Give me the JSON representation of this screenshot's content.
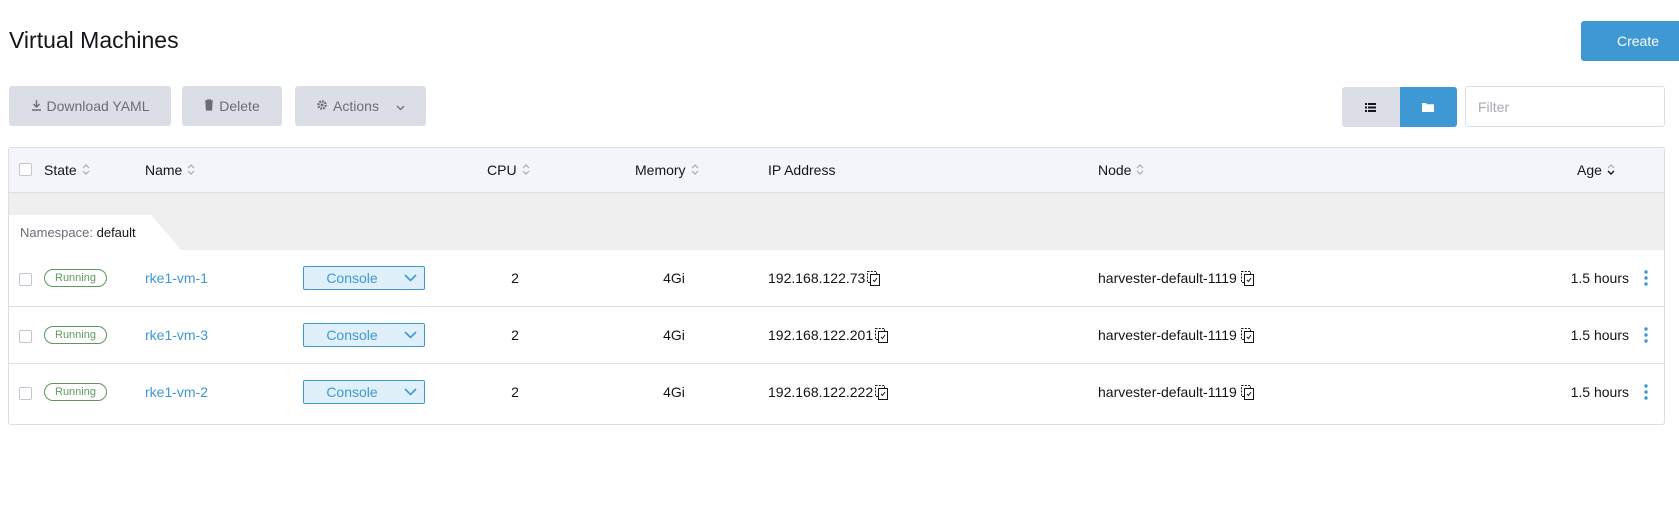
{
  "page": {
    "title": "Virtual Machines",
    "create_label": "Create"
  },
  "toolbar": {
    "download_label": "Download YAML",
    "delete_label": "Delete",
    "actions_label": "Actions",
    "filter_placeholder": "Filter"
  },
  "table": {
    "columns": {
      "state": "State",
      "name": "Name",
      "cpu": "CPU",
      "memory": "Memory",
      "ip": "IP Address",
      "node": "Node",
      "age": "Age"
    },
    "group": {
      "prefix": "Namespace:",
      "value": "default"
    },
    "rows": [
      {
        "state": "Running",
        "name": "rke1-vm-1",
        "console": "Console",
        "cpu": "2",
        "memory": "4Gi",
        "ip": "192.168.122.73",
        "node": "harvester-default-1119",
        "age": "1.5 hours"
      },
      {
        "state": "Running",
        "name": "rke1-vm-3",
        "console": "Console",
        "cpu": "2",
        "memory": "4Gi",
        "ip": "192.168.122.201",
        "node": "harvester-default-1119",
        "age": "1.5 hours"
      },
      {
        "state": "Running",
        "name": "rke1-vm-2",
        "console": "Console",
        "cpu": "2",
        "memory": "4Gi",
        "ip": "192.168.122.222",
        "node": "harvester-default-1119",
        "age": "1.5 hours"
      }
    ]
  },
  "colors": {
    "accent": "#3d98d3",
    "running": "#5d995d",
    "disabled_bg": "#dcdee7"
  },
  "icons": [
    "download-icon",
    "trash-icon",
    "gear-icon",
    "chevron-down-icon",
    "list-view-icon",
    "folder-view-icon",
    "sort-icon",
    "copy-icon",
    "kebab-icon"
  ]
}
